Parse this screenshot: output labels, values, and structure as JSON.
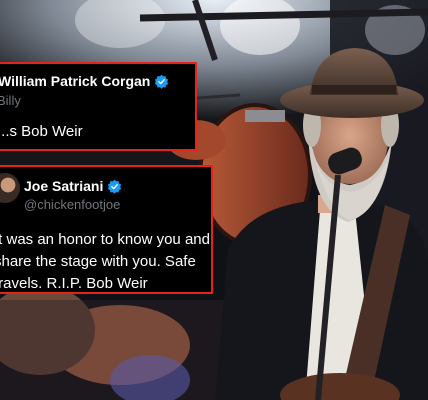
{
  "scene": {
    "description": "Concert photo of a gray-bearded musician in a brown hat singing into a microphone, playing guitar, drum kit in background"
  },
  "tweets": [
    {
      "display_name": "William Patrick Corgan",
      "handle": "Billy",
      "verified": true,
      "text": "...s Bob Weir"
    },
    {
      "display_name": "Joe Satriani",
      "handle": "@chickenfootjoe",
      "verified": true,
      "text_lines": [
        "It was an honor to know you and",
        "share the stage with you. Safe",
        "travels. R.I.P. Bob Weir"
      ]
    }
  ],
  "colors": {
    "card_border": "#e3241b",
    "verified_badge": "#1d9bf0",
    "handle_gray": "#71767b"
  }
}
